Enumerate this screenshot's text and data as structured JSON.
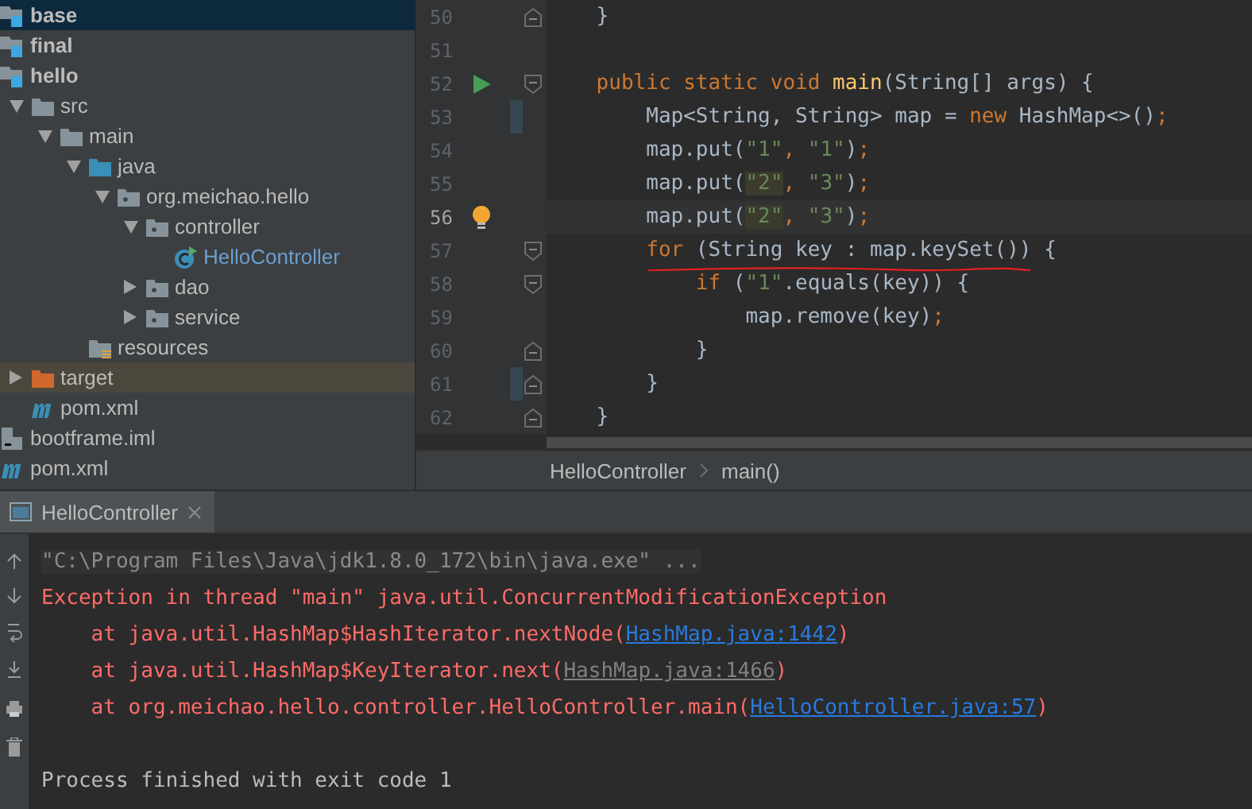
{
  "project_tree": [
    {
      "label": "base",
      "kind": "module",
      "selected": true
    },
    {
      "label": "final",
      "kind": "module",
      "selected": false
    },
    {
      "label": "hello",
      "kind": "module",
      "selected": false,
      "children": [
        {
          "label": "src",
          "kind": "folder",
          "expanded": true,
          "selected": false,
          "children": [
            {
              "label": "main",
              "kind": "folder",
              "expanded": true,
              "selected": false,
              "children": [
                {
                  "label": "java",
                  "kind": "source",
                  "expanded": true,
                  "selected": false,
                  "children": [
                    {
                      "label": "org.meichao.hello",
                      "kind": "package",
                      "expanded": true,
                      "selected": false,
                      "children": [
                        {
                          "label": "controller",
                          "kind": "package",
                          "expanded": true,
                          "selected": false,
                          "children": [
                            {
                              "label": "HelloController",
                              "kind": "class",
                              "selected": false
                            }
                          ]
                        },
                        {
                          "label": "dao",
                          "kind": "package",
                          "expanded": false,
                          "selected": false
                        },
                        {
                          "label": "service",
                          "kind": "package",
                          "expanded": false,
                          "selected": false
                        }
                      ]
                    }
                  ]
                },
                {
                  "label": "resources",
                  "kind": "resources",
                  "selected": false
                }
              ]
            }
          ]
        },
        {
          "label": "target",
          "kind": "excluded",
          "expanded": false,
          "selected": false
        },
        {
          "label": "pom.xml",
          "kind": "maven",
          "selected": false
        }
      ]
    },
    {
      "label": "bootframe.iml",
      "kind": "iml",
      "selected": false
    },
    {
      "label": "pom.xml",
      "kind": "maven",
      "selected": false
    }
  ],
  "editor": {
    "lines": [
      {
        "number": "50",
        "current": false,
        "gutter": [
          {
            "kind": "fold-end"
          }
        ],
        "tokens": [
          {
            "kind": "plain",
            "text": "    }"
          }
        ]
      },
      {
        "number": "51",
        "current": false
      },
      {
        "number": "52",
        "current": false,
        "gutter": [
          {
            "kind": "run"
          },
          {
            "kind": "fold-start"
          }
        ],
        "tokens": [
          {
            "kind": "keyword",
            "text": "    public static void "
          },
          {
            "kind": "method",
            "text": "main"
          },
          {
            "kind": "plain",
            "text": "(String[] args) {"
          }
        ]
      },
      {
        "number": "53",
        "current": false,
        "gutter": [
          {
            "kind": "change"
          }
        ],
        "tokens": [
          {
            "kind": "plain",
            "text": "        Map<String, String> map = "
          },
          {
            "kind": "keyword",
            "text": "new"
          },
          {
            "kind": "plain",
            "text": " HashMap<>()"
          },
          {
            "kind": "keyword",
            "text": ";"
          }
        ]
      },
      {
        "number": "54",
        "current": false,
        "tokens": [
          {
            "kind": "plain",
            "text": "        map.put("
          },
          {
            "kind": "string",
            "text": "\"1\""
          },
          {
            "kind": "keyword",
            "text": ","
          },
          {
            "kind": "string",
            "text": " \"1\""
          },
          {
            "kind": "plain",
            "text": ")"
          },
          {
            "kind": "keyword",
            "text": ";"
          }
        ]
      },
      {
        "number": "55",
        "current": false,
        "tokens": [
          {
            "kind": "plain",
            "text": "        map.put("
          },
          {
            "kind": "string-match",
            "text": "\"2\""
          },
          {
            "kind": "keyword",
            "text": ","
          },
          {
            "kind": "string",
            "text": " \"3\""
          },
          {
            "kind": "plain",
            "text": ")"
          },
          {
            "kind": "keyword",
            "text": ";"
          }
        ]
      },
      {
        "number": "56",
        "current": true,
        "gutter": [
          {
            "kind": "bulb"
          }
        ],
        "tokens": [
          {
            "kind": "plain",
            "text": "        map.put("
          },
          {
            "kind": "string-match",
            "text": "\"2\""
          },
          {
            "kind": "keyword",
            "text": ","
          },
          {
            "kind": "string",
            "text": " \"3\""
          },
          {
            "kind": "plain",
            "text": ")"
          },
          {
            "kind": "keyword",
            "text": ";"
          }
        ]
      },
      {
        "number": "57",
        "current": false,
        "gutter": [
          {
            "kind": "fold-start"
          }
        ],
        "annotation": {
          "kind": "red-underline"
        },
        "tokens": [
          {
            "kind": "keyword",
            "text": "        for"
          },
          {
            "kind": "plain",
            "text": " (String key : map.keySet()) {"
          }
        ]
      },
      {
        "number": "58",
        "current": false,
        "gutter": [
          {
            "kind": "fold-start"
          }
        ],
        "tokens": [
          {
            "kind": "keyword",
            "text": "            if"
          },
          {
            "kind": "plain",
            "text": " ("
          },
          {
            "kind": "string",
            "text": "\"1\""
          },
          {
            "kind": "plain",
            "text": ".equals(key)) {"
          }
        ]
      },
      {
        "number": "59",
        "current": false,
        "tokens": [
          {
            "kind": "plain",
            "text": "                map.remove(key)"
          },
          {
            "kind": "keyword",
            "text": ";"
          }
        ]
      },
      {
        "number": "60",
        "current": false,
        "gutter": [
          {
            "kind": "fold-end"
          }
        ],
        "tokens": [
          {
            "kind": "plain",
            "text": "            }"
          }
        ]
      },
      {
        "number": "61",
        "current": false,
        "gutter": [
          {
            "kind": "change"
          },
          {
            "kind": "fold-end"
          }
        ],
        "tokens": [
          {
            "kind": "plain",
            "text": "        }"
          }
        ]
      },
      {
        "number": "62",
        "current": false,
        "gutter": [
          {
            "kind": "fold-end"
          }
        ],
        "tokens": [
          {
            "kind": "plain",
            "text": "    }"
          }
        ]
      }
    ],
    "breadcrumbs": [
      "HelloController",
      "main()"
    ]
  },
  "run_panel": {
    "tab": "HelloController",
    "lines": [
      {
        "kind": "command",
        "text": "\"C:\\Program Files\\Java\\jdk1.8.0_172\\bin\\java.exe\" ..."
      },
      {
        "kind": "error",
        "text": "Exception in thread \"main\" java.util.ConcurrentModificationException"
      },
      {
        "kind": "trace",
        "text": "    at java.util.HashMap$HashIterator.nextNode(",
        "link": "HashMap.java:1442",
        "visited": false,
        "after": ")"
      },
      {
        "kind": "trace",
        "text": "    at java.util.HashMap$KeyIterator.next(",
        "link": "HashMap.java:1466",
        "visited": true,
        "after": ")"
      },
      {
        "kind": "trace",
        "text": "    at org.meichao.hello.controller.HelloController.main(",
        "link": "HelloController.java:57",
        "visited": false,
        "after": ")"
      },
      {
        "kind": "blank"
      },
      {
        "kind": "output",
        "text": "Process finished with exit code 1"
      }
    ]
  }
}
